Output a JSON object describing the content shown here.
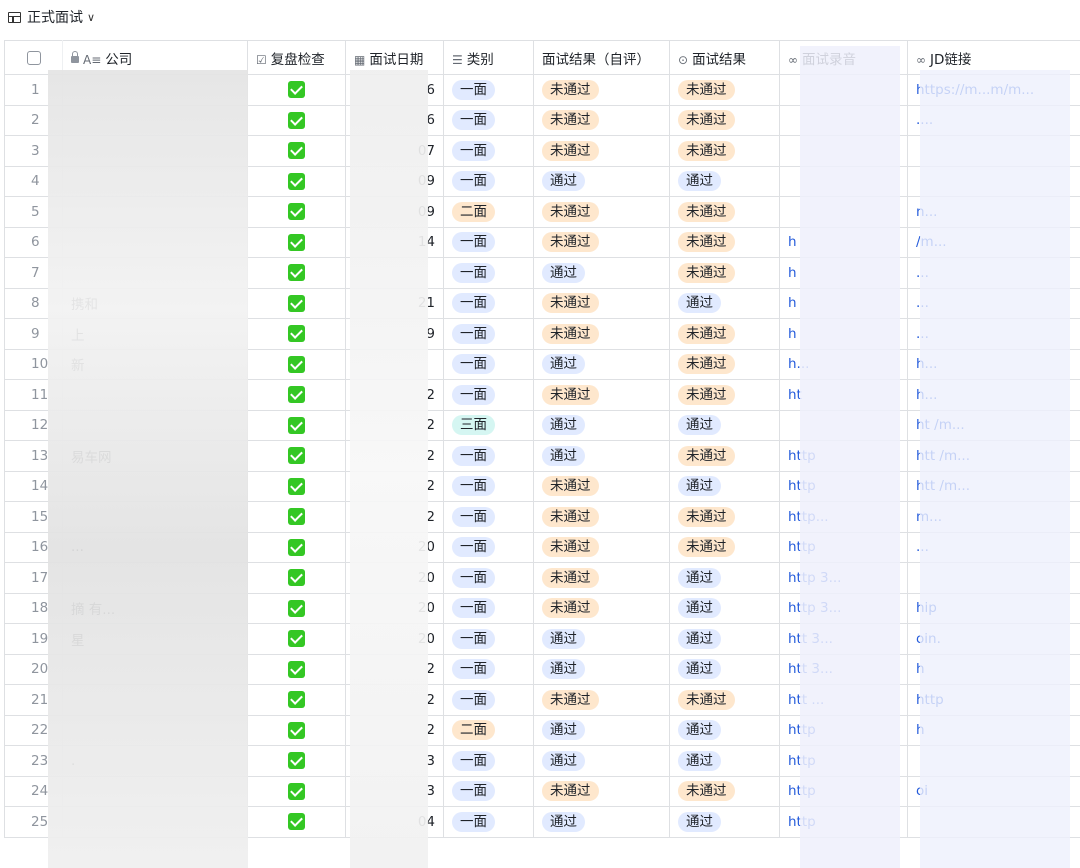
{
  "view": {
    "title": "正式面试"
  },
  "columns": [
    {
      "key": "company",
      "label": "公司",
      "icon": "text-field-icon"
    },
    {
      "key": "review",
      "label": "复盘检查",
      "icon": "checkbox-field-icon"
    },
    {
      "key": "date",
      "label": "面试日期",
      "icon": "date-field-icon"
    },
    {
      "key": "category",
      "label": "类别",
      "icon": "multi-select-field-icon"
    },
    {
      "key": "self_result",
      "label": "面试结果（自评）",
      "icon": ""
    },
    {
      "key": "result",
      "label": "面试结果",
      "icon": "single-select-field-icon"
    },
    {
      "key": "recording",
      "label": "面试录音",
      "icon": "link-field-icon"
    },
    {
      "key": "jd",
      "label": "JD链接",
      "icon": "link-field-icon"
    }
  ],
  "colors": {
    "tag_blue": "#e1eaff",
    "tag_orange": "#fee7cd",
    "tag_teal": "#d5f6f2",
    "check_green": "#34c724",
    "link": "#245bdb"
  },
  "rows": [
    {
      "n": "1",
      "company": "",
      "date": "6",
      "category": "一面",
      "cat_color": "blue",
      "self": "未通过",
      "res": "未通过",
      "rec": "",
      "jd": "https://m...m/m..."
    },
    {
      "n": "2",
      "company": "",
      "date": "6",
      "category": "一面",
      "cat_color": "blue",
      "self": "未通过",
      "res": "未通过",
      "rec": "",
      "jd": "...."
    },
    {
      "n": "3",
      "company": "",
      "date": "07",
      "category": "一面",
      "cat_color": "blue",
      "self": "未通过",
      "res": "未通过",
      "rec": "",
      "jd": ""
    },
    {
      "n": "4",
      "company": "",
      "date": "09",
      "category": "一面",
      "cat_color": "blue",
      "self": "通过",
      "res": "通过",
      "rec": "",
      "jd": ""
    },
    {
      "n": "5",
      "company": "",
      "date": "09",
      "category": "二面",
      "cat_color": "orange",
      "self": "未通过",
      "res": "未通过",
      "rec": "",
      "jd": "n..."
    },
    {
      "n": "6",
      "company": "",
      "date": "14",
      "category": "一面",
      "cat_color": "blue",
      "self": "未通过",
      "res": "未通过",
      "rec": "h",
      "jd": "/m..."
    },
    {
      "n": "7",
      "company": "",
      "date": "",
      "category": "一面",
      "cat_color": "blue",
      "self": "通过",
      "res": "未通过",
      "rec": "h",
      "jd": "..."
    },
    {
      "n": "8",
      "company": "携和",
      "date": "21",
      "category": "一面",
      "cat_color": "blue",
      "self": "未通过",
      "res": "通过",
      "rec": "h",
      "jd": "..."
    },
    {
      "n": "9",
      "company": "上",
      "date": "9",
      "category": "一面",
      "cat_color": "blue",
      "self": "未通过",
      "res": "未通过",
      "rec": "h",
      "jd": "..."
    },
    {
      "n": "10",
      "company": "新",
      "date": "",
      "category": "一面",
      "cat_color": "blue",
      "self": "通过",
      "res": "未通过",
      "rec": "h...",
      "jd": "h..."
    },
    {
      "n": "11",
      "company": "",
      "date": "2",
      "category": "一面",
      "cat_color": "blue",
      "self": "未通过",
      "res": "未通过",
      "rec": "ht",
      "jd": "h..."
    },
    {
      "n": "12",
      "company": "",
      "date": "2",
      "category": "三面",
      "cat_color": "teal",
      "self": "通过",
      "res": "通过",
      "rec": "",
      "jd": "ht /m..."
    },
    {
      "n": "13",
      "company": "易车网",
      "date": "2",
      "category": "一面",
      "cat_color": "blue",
      "self": "通过",
      "res": "未通过",
      "rec": "http",
      "jd": "htt /m..."
    },
    {
      "n": "14",
      "company": "",
      "date": "2",
      "category": "一面",
      "cat_color": "blue",
      "self": "未通过",
      "res": "通过",
      "rec": "http",
      "jd": "htt /m..."
    },
    {
      "n": "15",
      "company": "",
      "date": "2",
      "category": "一面",
      "cat_color": "blue",
      "self": "未通过",
      "res": "未通过",
      "rec": "http...",
      "jd": "m..."
    },
    {
      "n": "16",
      "company": "...",
      "date": "20",
      "category": "一面",
      "cat_color": "blue",
      "self": "未通过",
      "res": "未通过",
      "rec": "http",
      "jd": "..."
    },
    {
      "n": "17",
      "company": "",
      "date": "20",
      "category": "一面",
      "cat_color": "blue",
      "self": "未通过",
      "res": "通过",
      "rec": "http 3...",
      "jd": ""
    },
    {
      "n": "18",
      "company": "摘 有...",
      "date": "20",
      "category": "一面",
      "cat_color": "blue",
      "self": "未通过",
      "res": "通过",
      "rec": "http 3...",
      "jd": "hip"
    },
    {
      "n": "19",
      "company": "星",
      "date": "20",
      "category": "一面",
      "cat_color": "blue",
      "self": "通过",
      "res": "通过",
      "rec": "htt 3...",
      "jd": "oin."
    },
    {
      "n": "20",
      "company": "",
      "date": "2",
      "category": "一面",
      "cat_color": "blue",
      "self": "通过",
      "res": "通过",
      "rec": "htt 3...",
      "jd": "h"
    },
    {
      "n": "21",
      "company": "",
      "date": "2",
      "category": "一面",
      "cat_color": "blue",
      "self": "未通过",
      "res": "未通过",
      "rec": "htt ...",
      "jd": "http"
    },
    {
      "n": "22",
      "company": "",
      "date": "2",
      "category": "二面",
      "cat_color": "orange",
      "self": "通过",
      "res": "通过",
      "rec": "http",
      "jd": "h"
    },
    {
      "n": "23",
      "company": ".",
      "date": "3",
      "category": "一面",
      "cat_color": "blue",
      "self": "通过",
      "res": "通过",
      "rec": "http",
      "jd": ""
    },
    {
      "n": "24",
      "company": "",
      "date": "3",
      "category": "一面",
      "cat_color": "blue",
      "self": "未通过",
      "res": "未通过",
      "rec": "http",
      "jd": "oi"
    },
    {
      "n": "25",
      "company": "",
      "date": "04",
      "category": "一面",
      "cat_color": "blue",
      "self": "通过",
      "res": "通过",
      "rec": "http",
      "jd": ""
    }
  ]
}
